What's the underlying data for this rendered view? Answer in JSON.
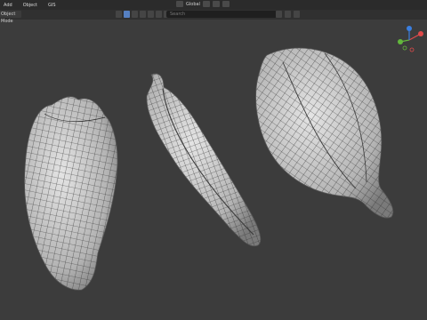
{
  "header": {
    "menus": [
      "Add",
      "Object",
      "GIS"
    ],
    "transform_orientation": "Global"
  },
  "toolbar": {
    "mode": "Object Mode",
    "search_placeholder": "Search"
  },
  "colors": {
    "viewport_bg": "#3c3c3c",
    "mesh_fill": "#c8c8c8",
    "wire": "#303030",
    "gizmo_x": "#e04a4a",
    "gizmo_y": "#62b73c",
    "gizmo_z": "#3a7fe0"
  },
  "icons": [
    "select-icon",
    "transform-icon",
    "snap-icon",
    "filter-icon",
    "gizmo-icon"
  ]
}
